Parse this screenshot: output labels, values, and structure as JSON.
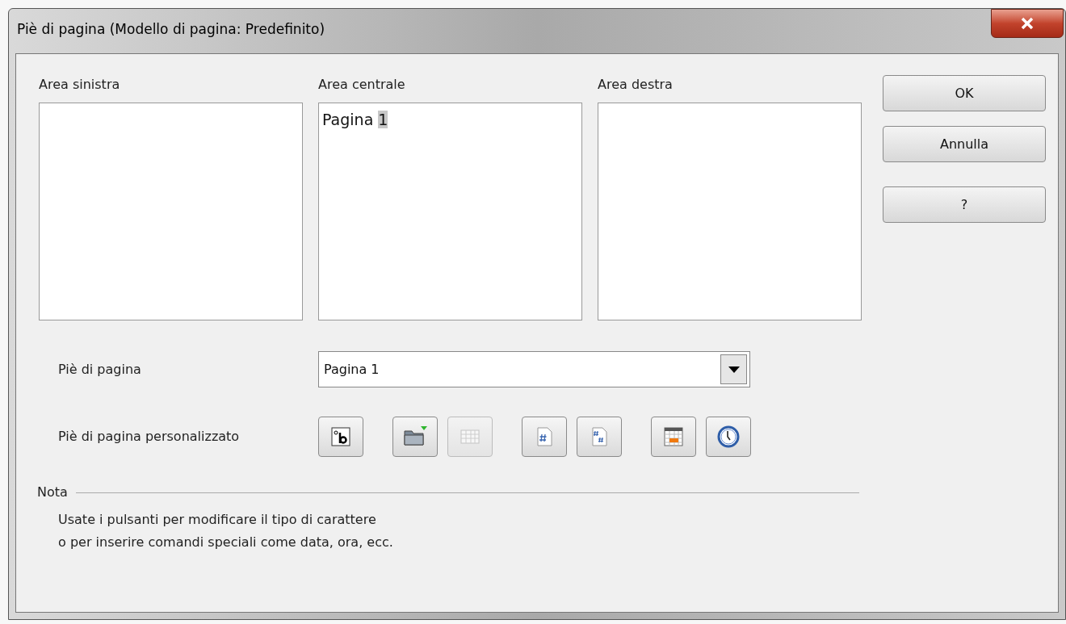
{
  "window": {
    "title": "Piè di pagina (Modello di pagina: Predefinito)"
  },
  "areas": [
    {
      "label": "Area sinistra"
    },
    {
      "label": "Area centrale",
      "text": "Pagina",
      "selection": "1"
    },
    {
      "label": "Area destra"
    }
  ],
  "buttons": [
    {
      "label": "OK"
    },
    {
      "label": "Annulla"
    },
    {
      "label": "?"
    }
  ],
  "footer": {
    "label": "Piè di pagina",
    "value": "Pagina 1"
  },
  "custom": {
    "label": "Piè di pagina personalizzato",
    "groups": [
      [
        {
          "kind": "text-attributes",
          "disabled": false
        }
      ],
      [
        {
          "kind": "file",
          "disabled": false
        },
        {
          "kind": "table",
          "disabled": true
        }
      ],
      [
        {
          "kind": "page",
          "disabled": false
        },
        {
          "kind": "pages",
          "disabled": false
        }
      ],
      [
        {
          "kind": "date",
          "disabled": false
        },
        {
          "kind": "time",
          "disabled": false
        }
      ]
    ]
  },
  "note": {
    "title": "Nota",
    "lines": [
      "Usate i pulsanti per modificare il tipo di carattere",
      "o per inserire comandi speciali come data, ora, ecc."
    ]
  }
}
